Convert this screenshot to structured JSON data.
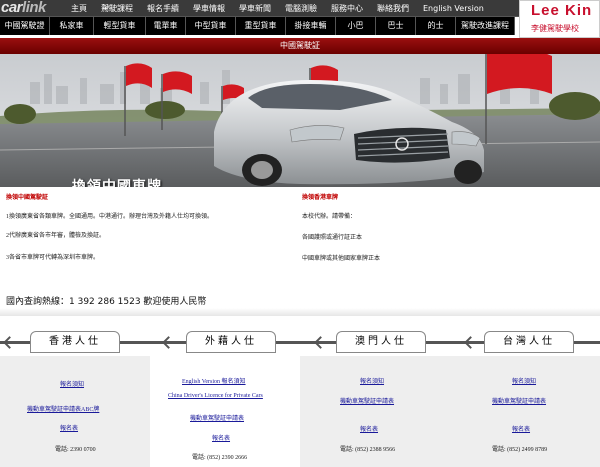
{
  "topnav": [
    "主頁",
    "駕駛課程",
    "報名手續",
    "學車情報",
    "學車新聞",
    "電腦測驗",
    "服務中心",
    "聯絡我們",
    "English Version"
  ],
  "site_logo": {
    "car": "car",
    "link": "link",
    "hk": ".hk"
  },
  "catnav": [
    "中國駕駛證",
    "私家車",
    "輕型貨車",
    "電單車",
    "中型貨車",
    "重型貨車",
    "掛接車輛",
    "小巴",
    "巴士",
    "的士",
    "駕駛改進課程"
  ],
  "brand": {
    "en": "Lee Kin",
    "zh": "李健駕駛學校"
  },
  "page_title": "中國駕駛証",
  "banner_text": "換領中國車牌",
  "left_section": {
    "title": "換領中國駕駛証",
    "lines": [
      "1換領廣東省各類車牌。全國通用。中港通行。辦理台灣及外籍人仕均可換領。",
      "2代辦廣東省各市年審，體檢及換証。",
      "3各省市車牌可代轉為深圳市車牌。"
    ]
  },
  "right_section": {
    "title": "換領香港車牌",
    "lines": [
      "本校代辦。請帶備：",
      "各國護照或通行証正本",
      "中國車牌或其他國家車牌正本"
    ]
  },
  "hotline": "國內查詢熱線：1 392 286 1523 歡迎使用人民幣",
  "regions": [
    {
      "name": "香港人仕",
      "lines": [
        {
          "t": "報名須知",
          "link": true
        },
        {
          "t": "機動車駕駛証申請表ABC牌",
          "link": true
        },
        {
          "t": "報名表",
          "link": true
        },
        {
          "t": "電話: 2390 0700",
          "link": false
        }
      ]
    },
    {
      "name": "外藉人仕",
      "lines": [
        {
          "t": "English Version 報名須知",
          "link": true
        },
        {
          "t": "China Driver's Licence for Private Cars",
          "link": true
        },
        {
          "t": "機動車駕駛証申請表",
          "link": true
        },
        {
          "t": "報名表",
          "link": true
        },
        {
          "t": "電話: (852) 2390 2666",
          "link": false
        }
      ]
    },
    {
      "name": "澳門人仕",
      "lines": [
        {
          "t": "報名須知",
          "link": true
        },
        {
          "t": "機動車駕駛証申請表",
          "link": true
        },
        {
          "t": "報名表",
          "link": true
        },
        {
          "t": "電話: (852) 2388 9566",
          "link": false
        }
      ]
    },
    {
      "name": "台灣人仕",
      "lines": [
        {
          "t": "報名須知",
          "link": true
        },
        {
          "t": "機動車駕駛証申請表",
          "link": true
        },
        {
          "t": "報名表",
          "link": true
        },
        {
          "t": "電話: (852) 2499 8789",
          "link": false
        }
      ]
    }
  ],
  "colors": {
    "accent": "#c8102e",
    "dark_red": "#7a0000",
    "topbar": "#3a3a3a",
    "catbar": "#000000"
  }
}
